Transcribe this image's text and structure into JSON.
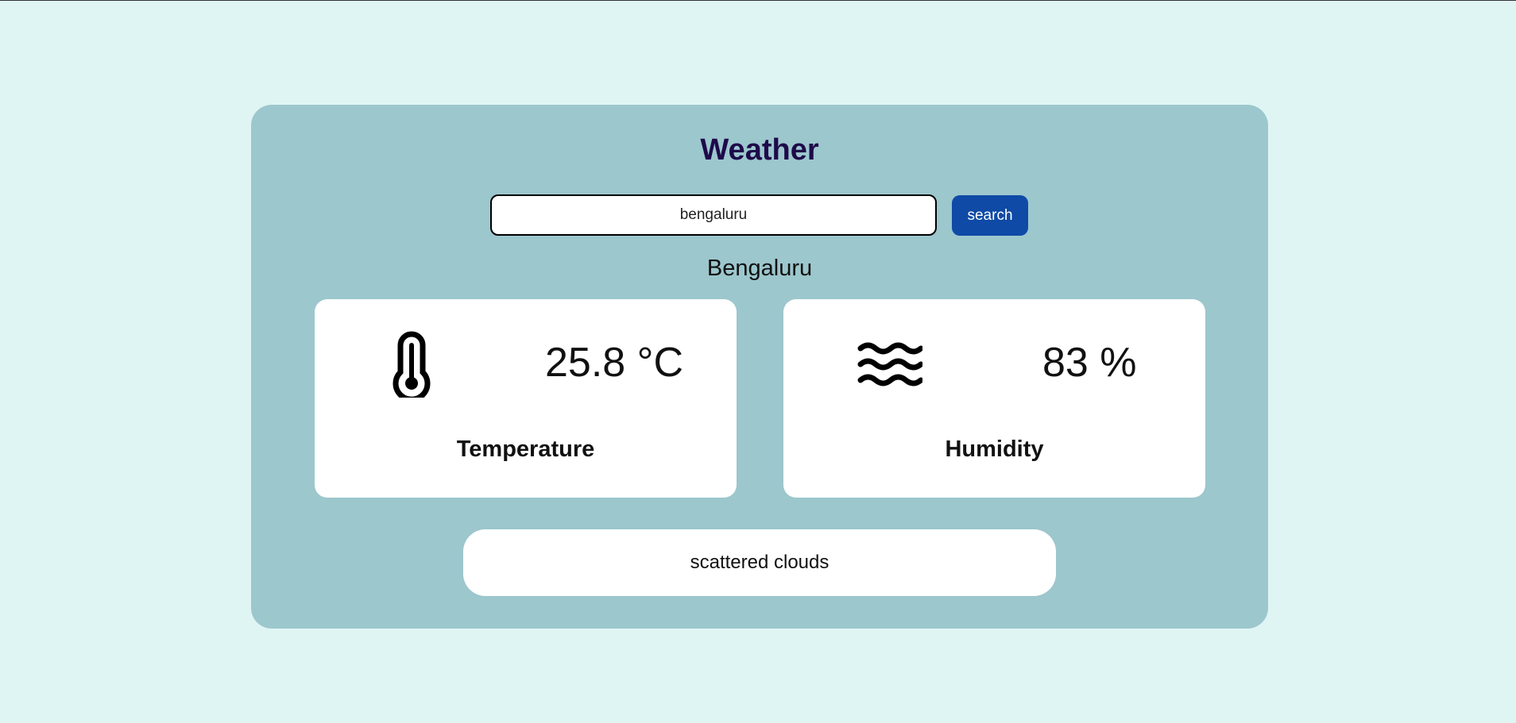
{
  "app": {
    "title": "Weather"
  },
  "search": {
    "value": "bengaluru",
    "button_label": "search"
  },
  "location": {
    "city": "Bengaluru"
  },
  "metrics": {
    "temperature": {
      "value": "25.8 °C",
      "label": "Temperature",
      "icon": "thermometer-icon"
    },
    "humidity": {
      "value": "83 %",
      "label": "Humidity",
      "icon": "humidity-waves-icon"
    }
  },
  "conditions": {
    "description": "scattered clouds"
  },
  "colors": {
    "page_background": "#dff5f3",
    "card_background": "#9cc7cd",
    "title": "#1e0a4a",
    "button": "#0e4aa6"
  }
}
